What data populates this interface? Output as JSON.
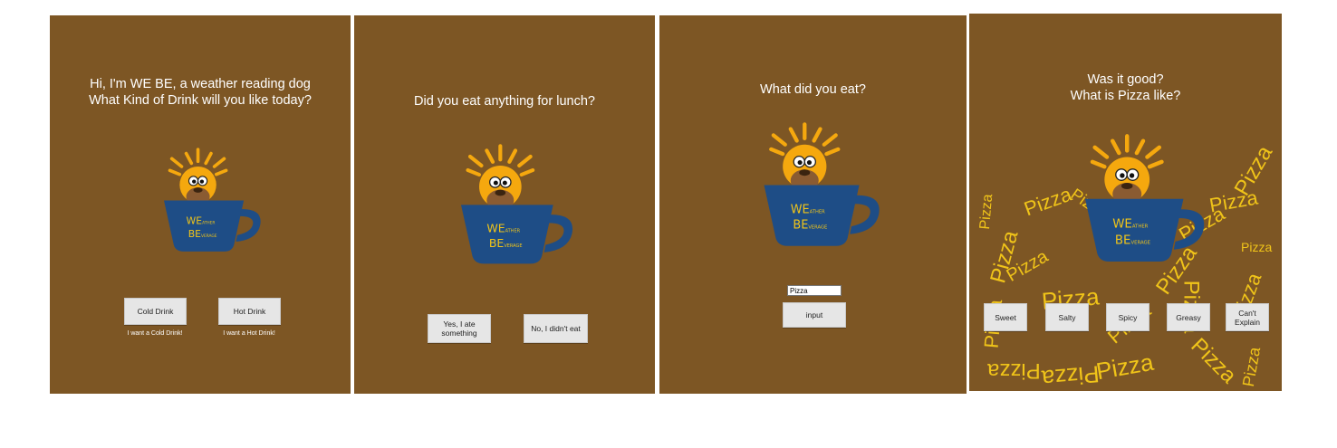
{
  "colors": {
    "panel_bg": "#7d5624",
    "cup": "#1e4d86",
    "sun": "#f5a80e",
    "dog": "#8a5b32",
    "brand_text": "#f0c419",
    "scatter_text": "#f0c419"
  },
  "logo": {
    "we_big": "WE",
    "we_small": "ATHER",
    "be_big": "BE",
    "be_small": "VERAGE"
  },
  "screens": [
    {
      "title": "Hi, I'm WE BE, a weather reading dog\nWhat Kind of Drink will you like today?",
      "buttons": [
        "Cold Drink",
        "Hot Drink"
      ],
      "captions": [
        "I want a Cold Drink!",
        "I want a Hot Drink!"
      ]
    },
    {
      "title": "Did you eat anything for lunch?",
      "buttons": [
        "Yes, I ate something",
        "No, I didn't eat"
      ]
    },
    {
      "title": "What did you eat?",
      "input_value": "Pizza",
      "button": "input"
    },
    {
      "title": "Was it good?\nWhat is Pizza like?",
      "buttons": [
        "Sweet",
        "Salty",
        "Spicy",
        "Greasy",
        "Can't Explain"
      ],
      "scatter_word": "Pizza"
    }
  ]
}
